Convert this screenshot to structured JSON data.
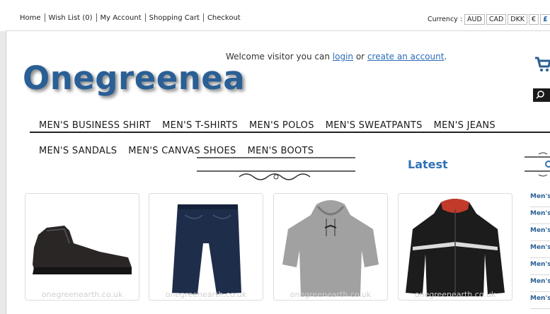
{
  "toplinks": {
    "home": "Home",
    "wishlist": "Wish List (0)",
    "account": "My Account",
    "cart": "Shopping Cart",
    "checkout": "Checkout"
  },
  "currency": {
    "label": "Currency :",
    "options": [
      "AUD",
      "CAD",
      "DKK",
      "€",
      "£"
    ],
    "active": "£"
  },
  "header": {
    "logo": "Onegreenea",
    "welcome_prefix": "Welcome visitor you can",
    "login": "login",
    "or": "or",
    "create_account": "create an account",
    "welcome_suffix": "."
  },
  "nav": {
    "row1": [
      "MEN'S BUSINESS SHIRT",
      "MEN'S T-SHIRTS",
      "MEN'S POLOS",
      "MEN'S SWEATPANTS",
      "MEN'S JEANS"
    ],
    "row2": [
      "MEN'S SANDALS",
      "MEN'S CANVAS SHOES",
      "MEN'S BOOTS"
    ]
  },
  "latest": {
    "title": "Latest"
  },
  "products": [
    {
      "watermark": "onegreenearth.co.uk",
      "icon": "boot"
    },
    {
      "watermark": "onegreenearth.co.uk",
      "icon": "shorts"
    },
    {
      "watermark": "onegreenearth.co.uk",
      "icon": "hoodie"
    },
    {
      "watermark": "onegreenearth.co.uk",
      "icon": "jacket"
    }
  ],
  "sidebar": {
    "items": [
      "Men's",
      "Men's",
      "Men's",
      "Men's",
      "Men's",
      "Men's",
      "Men's"
    ]
  },
  "colors": {
    "brand": "#2a5f95",
    "link": "#2a6ab8",
    "heading": "#2f72b5"
  }
}
